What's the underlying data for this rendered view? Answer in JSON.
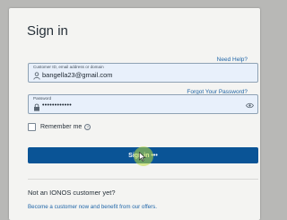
{
  "form": {
    "title": "Sign in",
    "need_help": "Need Help?",
    "email_label": "Customer ID, email address or domain",
    "email_value": "bangella23@gmail.com",
    "password_label": "Password",
    "password_value": "••••••••••••",
    "forgot_password": "Forgot Your Password?",
    "remember_me": "Remember me",
    "help_glyph": "?",
    "signin_label": "Sign in •••"
  },
  "footer": {
    "question": "Not an IONOS customer yet?",
    "become_link": "Become a customer now and benefit from our offers."
  },
  "colors": {
    "primary": "#0a5496",
    "link": "#1f65a8",
    "field_bg": "#e8f0fb"
  },
  "icons": [
    "user-icon",
    "lock-icon",
    "eye-icon",
    "help-icon",
    "mouse-cursor-icon"
  ]
}
